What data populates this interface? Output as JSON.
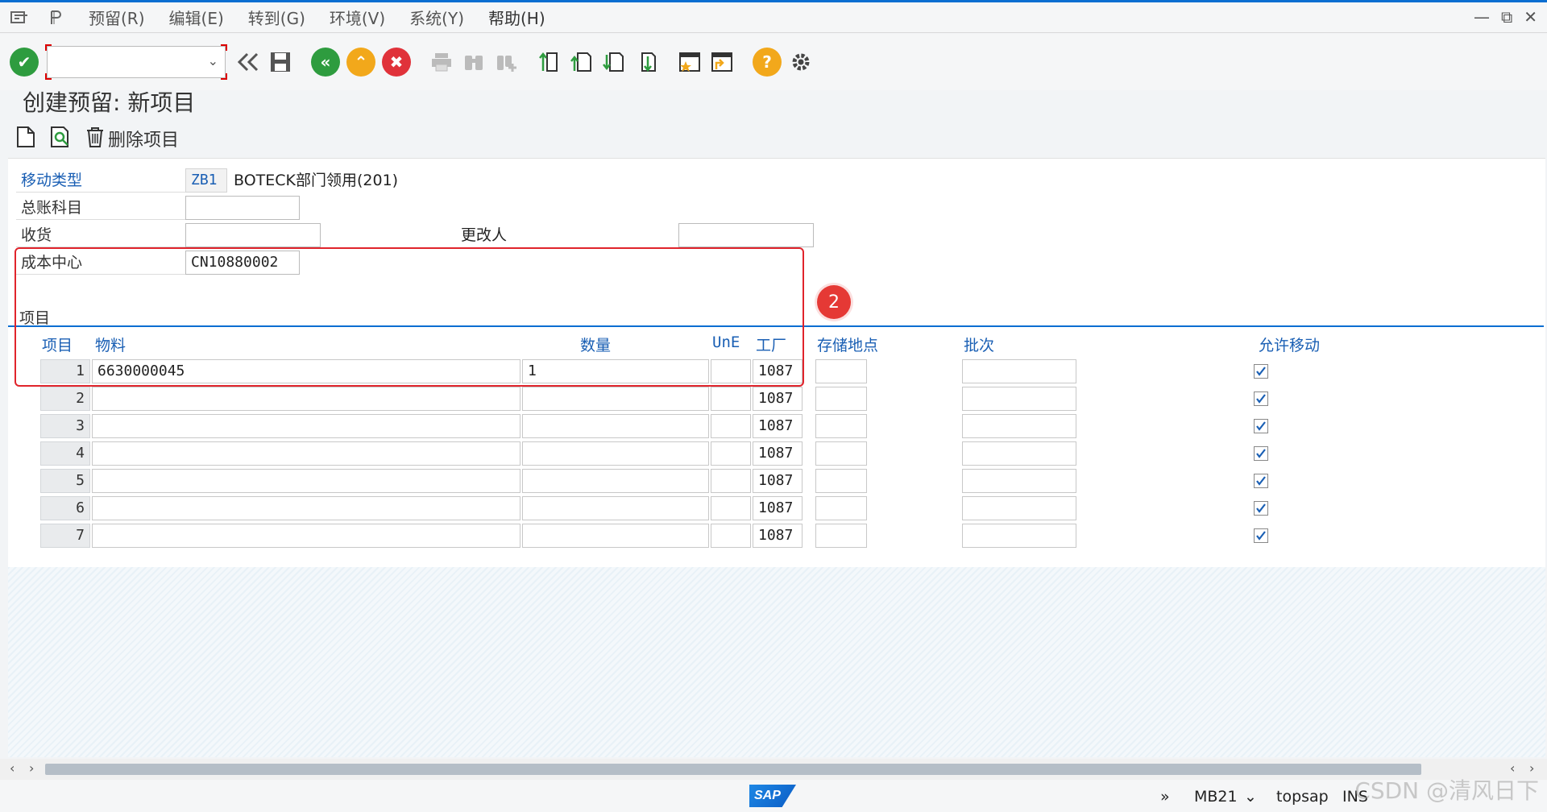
{
  "menu": {
    "items": [
      "预留(R)",
      "编辑(E)",
      "转到(G)",
      "环境(V)",
      "系统(Y)",
      "帮助(H)"
    ]
  },
  "toolbar": {
    "command_value": "",
    "icons": [
      "enter-icon",
      "back-icon",
      "save-icon",
      "back-green-icon",
      "exit-icon",
      "cancel-icon",
      "print-icon",
      "find-icon",
      "find-next-icon",
      "first-page-icon",
      "prev-page-icon",
      "next-page-icon",
      "last-page-icon",
      "create-session-icon",
      "create-shortcut-icon",
      "help-icon",
      "settings-icon"
    ]
  },
  "page": {
    "title": "创建预留: 新项目"
  },
  "app_toolbar": {
    "delete_item_label": "删除项目"
  },
  "header": {
    "movement_type_label": "移动类型",
    "movement_type_value": "ZB1",
    "movement_type_desc": "BOTECK部门领用(201)",
    "gl_account_label": "总账科目",
    "gl_account_value": "",
    "goods_recipient_label": "收货",
    "goods_recipient_value": "",
    "changed_by_label": "更改人",
    "changed_by_value": "",
    "cost_center_label": "成本中心",
    "cost_center_value": "CN10880002"
  },
  "items_section": {
    "title": "项目",
    "columns": [
      "项目",
      "物料",
      "数量",
      "UnE",
      "工厂",
      "存储地点",
      "批次",
      "允许移动"
    ],
    "rows": [
      {
        "item": "1",
        "material": "6630000045",
        "quantity": "1",
        "unit": "",
        "plant": "1087",
        "storage": "",
        "batch": "",
        "allow": true
      },
      {
        "item": "2",
        "material": "",
        "quantity": "",
        "unit": "",
        "plant": "1087",
        "storage": "",
        "batch": "",
        "allow": true
      },
      {
        "item": "3",
        "material": "",
        "quantity": "",
        "unit": "",
        "plant": "1087",
        "storage": "",
        "batch": "",
        "allow": true
      },
      {
        "item": "4",
        "material": "",
        "quantity": "",
        "unit": "",
        "plant": "1087",
        "storage": "",
        "batch": "",
        "allow": true
      },
      {
        "item": "5",
        "material": "",
        "quantity": "",
        "unit": "",
        "plant": "1087",
        "storage": "",
        "batch": "",
        "allow": true
      },
      {
        "item": "6",
        "material": "",
        "quantity": "",
        "unit": "",
        "plant": "1087",
        "storage": "",
        "batch": "",
        "allow": true
      },
      {
        "item": "7",
        "material": "",
        "quantity": "",
        "unit": "",
        "plant": "1087",
        "storage": "",
        "batch": "",
        "allow": true
      }
    ]
  },
  "annotation": {
    "badge": "2"
  },
  "statusbar": {
    "logo": "SAP",
    "transaction": "MB21",
    "user": "topsap",
    "mode": "INS",
    "watermark": "CSDN @清风日下"
  },
  "colors": {
    "accent": "#0a6ed1",
    "link": "#1a5fb4",
    "annotation_red": "#e0242c"
  }
}
